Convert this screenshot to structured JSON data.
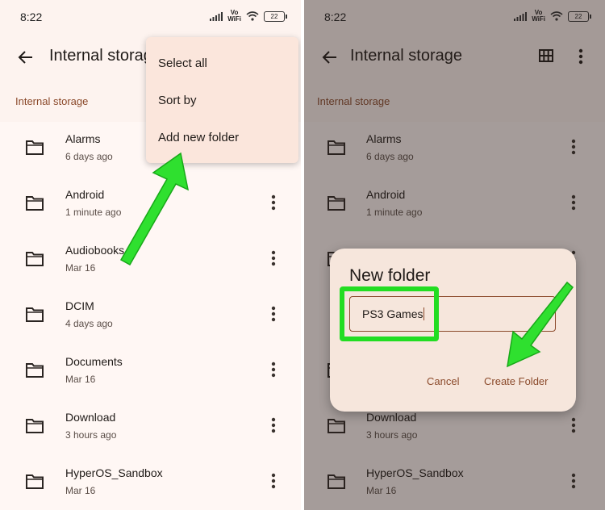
{
  "left": {
    "status": {
      "time": "8:22",
      "vowifi_top": "Vo",
      "vowifi_bottom": "WiFi",
      "battery": "22"
    },
    "toolbar": {
      "title": "Internal storage"
    },
    "breadcrumb": "Internal storage",
    "menu": [
      {
        "label": "Select all"
      },
      {
        "label": "Sort by"
      },
      {
        "label": "Add new folder"
      }
    ],
    "files": [
      {
        "name": "Alarms",
        "date": "6 days ago"
      },
      {
        "name": "Android",
        "date": "1 minute ago"
      },
      {
        "name": "Audiobooks",
        "date": "Mar 16"
      },
      {
        "name": "DCIM",
        "date": "4 days ago"
      },
      {
        "name": "Documents",
        "date": "Mar 16"
      },
      {
        "name": "Download",
        "date": "3 hours ago"
      },
      {
        "name": "HyperOS_Sandbox",
        "date": "Mar 16"
      }
    ]
  },
  "right": {
    "status": {
      "time": "8:22",
      "vowifi_top": "Vo",
      "vowifi_bottom": "WiFi",
      "battery": "22"
    },
    "toolbar": {
      "title": "Internal storage"
    },
    "breadcrumb": "Internal storage",
    "files": [
      {
        "name": "Alarms",
        "date": "6 days ago"
      },
      {
        "name": "Android",
        "date": "1 minute ago"
      },
      {
        "name": "Download",
        "date": "3 hours ago"
      },
      {
        "name": "HyperOS_Sandbox",
        "date": "Mar 16"
      }
    ],
    "dialog": {
      "title": "New folder",
      "input_value": "PS3 Games",
      "cancel_label": "Cancel",
      "create_label": "Create Folder"
    }
  },
  "colors": {
    "accent": "#8b4a2b",
    "highlight": "#22dd22",
    "surface": "#fdf3ef"
  },
  "icons": [
    "back-arrow-icon",
    "grid-view-icon",
    "more-vert-icon",
    "folder-icon",
    "signal-icon",
    "wifi-icon",
    "battery-icon"
  ]
}
